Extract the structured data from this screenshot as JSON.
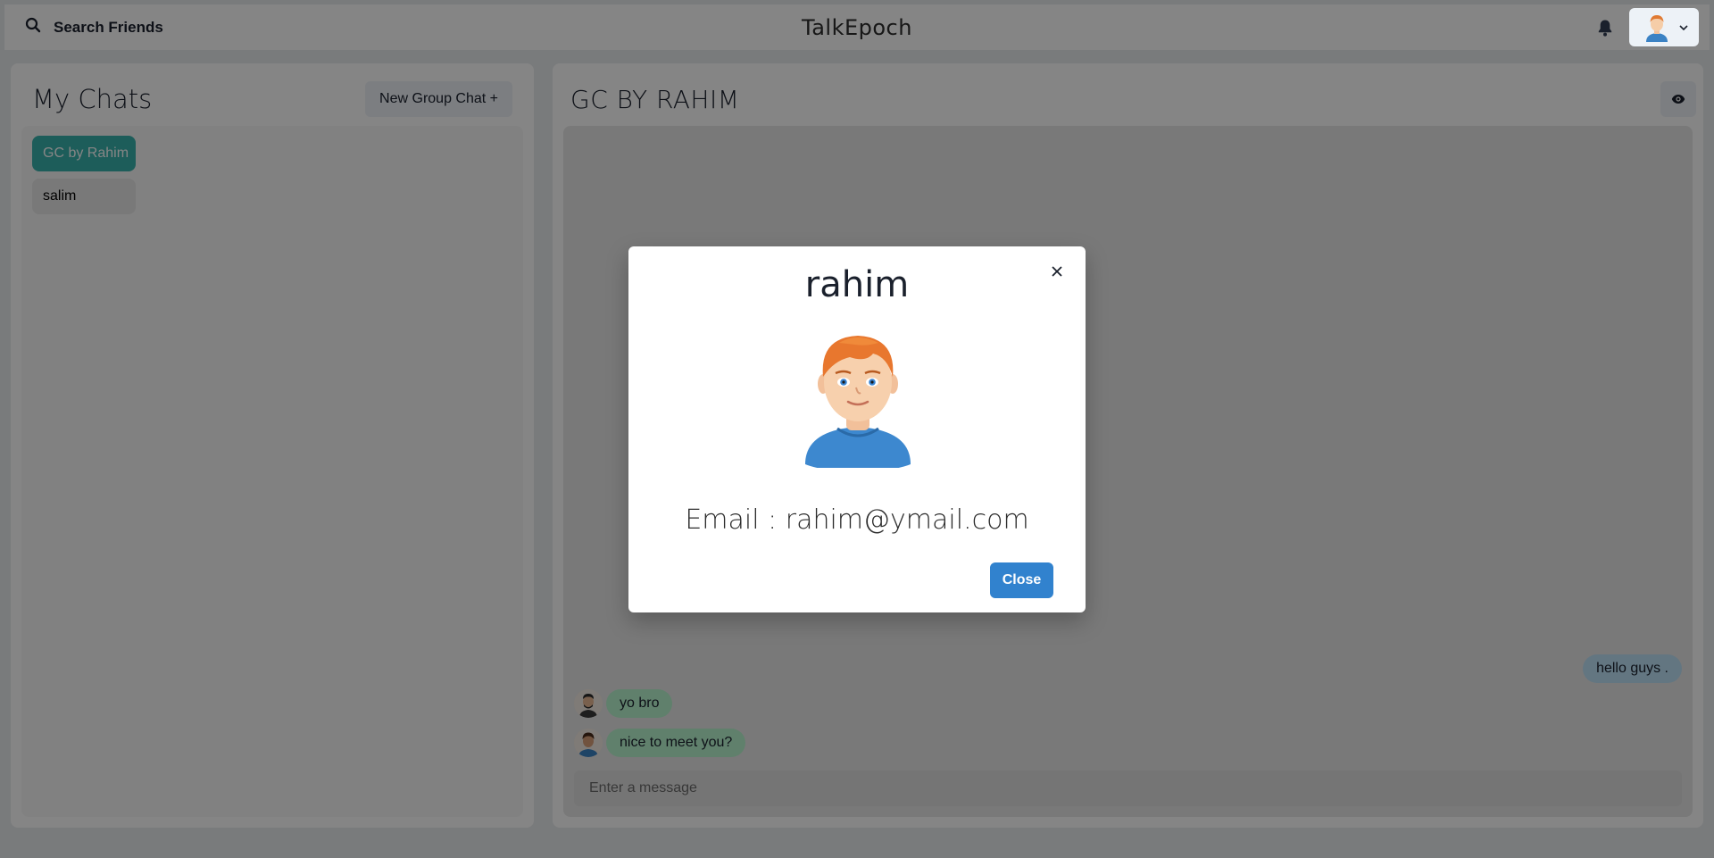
{
  "topbar": {
    "search_label": "Search Friends",
    "app_title": "TalkEpoch"
  },
  "chats": {
    "title": "My Chats",
    "new_group_label": "New Group Chat +",
    "items": [
      {
        "label": "GC by Rahim",
        "active": true
      },
      {
        "label": "salim",
        "active": false
      }
    ]
  },
  "chat": {
    "title": "GC BY RAHIM",
    "messages": [
      {
        "text": "hello guys .",
        "side": "sent"
      },
      {
        "text": "yo bro",
        "side": "received"
      },
      {
        "text": "nice to meet you?",
        "side": "received"
      }
    ],
    "input_placeholder": "Enter a message"
  },
  "modal": {
    "name": "rahim",
    "email_line": "Email : rahim@ymail.com",
    "close_label": "Close"
  },
  "colors": {
    "active_chat": "#38b2ac",
    "sent_bubble": "#bee3f8",
    "received_bubble": "#b9f5d0",
    "primary_button": "#3182ce"
  },
  "icons": [
    "search-icon",
    "bell-icon",
    "chevron-down-icon",
    "eye-icon",
    "close-icon"
  ]
}
